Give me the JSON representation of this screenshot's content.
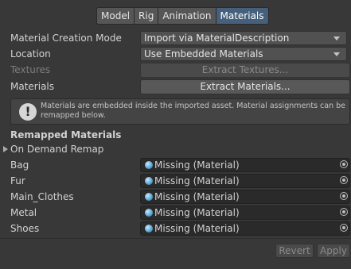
{
  "tabs": [
    "Model",
    "Rig",
    "Animation",
    "Materials"
  ],
  "active_tab": "Materials",
  "material_creation_mode": {
    "label": "Material Creation Mode",
    "value": "Import via MaterialDescription"
  },
  "location": {
    "label": "Location",
    "value": "Use Embedded Materials"
  },
  "textures": {
    "label": "Textures",
    "button": "Extract Textures..."
  },
  "materials": {
    "label": "Materials",
    "button": "Extract Materials..."
  },
  "help": {
    "icon": "warning-exclamation-icon",
    "text": "Materials are embedded inside the imported asset. Material assignments can be remapped below."
  },
  "remapped": {
    "title": "Remapped Materials",
    "foldout_label": "On Demand Remap",
    "items": [
      {
        "label": "Bag",
        "value": "Missing (Material)"
      },
      {
        "label": "Fur",
        "value": "Missing (Material)"
      },
      {
        "label": "Main_Clothes",
        "value": "Missing (Material)"
      },
      {
        "label": "Metal",
        "value": "Missing (Material)"
      },
      {
        "label": "Shoes",
        "value": "Missing (Material)"
      }
    ]
  },
  "footer": {
    "revert": "Revert",
    "apply": "Apply"
  },
  "colors": {
    "background": "#383838",
    "active_tab": "#46607c",
    "material_icon": "#6fb4e0"
  }
}
